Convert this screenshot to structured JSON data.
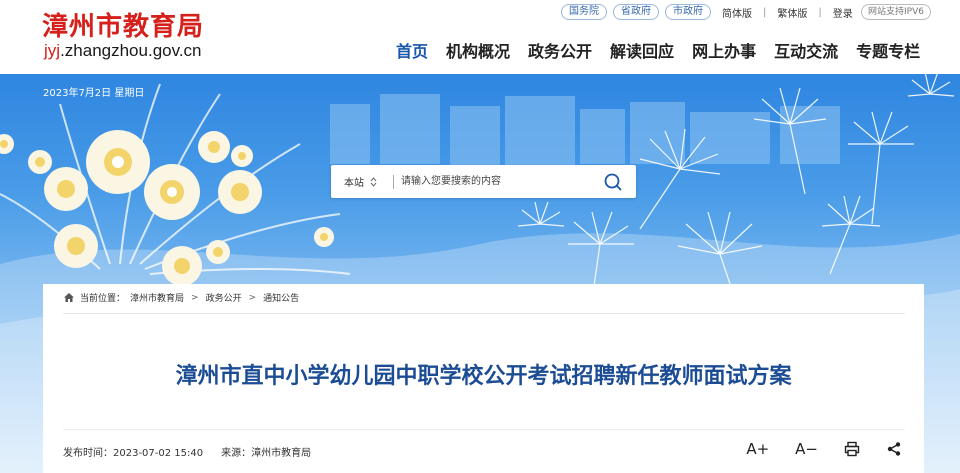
{
  "site": {
    "title": "漳州市教育局",
    "domain_prefix": "jyj",
    "domain_rest": ".zhangzhou.gov.cn"
  },
  "top_links": [
    "国务院",
    "省政府",
    "市政府"
  ],
  "utility": {
    "simplified": "简体版",
    "traditional": "繁体版",
    "login": "登录",
    "ipv6": "网站支持IPV6"
  },
  "nav": [
    {
      "label": "首页",
      "active": true
    },
    {
      "label": "机构概况",
      "active": false
    },
    {
      "label": "政务公开",
      "active": false
    },
    {
      "label": "解读回应",
      "active": false
    },
    {
      "label": "网上办事",
      "active": false
    },
    {
      "label": "互动交流",
      "active": false
    },
    {
      "label": "专题专栏",
      "active": false
    }
  ],
  "banner": {
    "date": "2023年7月2日 星期日"
  },
  "search": {
    "scope": "本站",
    "placeholder": "请输入您要搜索的内容",
    "icon": "search-icon"
  },
  "breadcrumb": {
    "prefix": "当前位置：",
    "items": [
      "漳州市教育局",
      "政务公开",
      "通知公告"
    ],
    "separator": ">"
  },
  "article": {
    "title": "漳州市直中小学幼儿园中职学校公开考试招聘新任教师面试方案",
    "publish_label": "发布时间：",
    "publish_time": "2023-07-02 15:40",
    "source_label": "来源：",
    "source": "漳州市教育局"
  },
  "tools": {
    "font_up": "A+",
    "font_down": "A−"
  },
  "colors": {
    "brand_red": "#d6201b",
    "nav_active": "#1756a8",
    "title_blue": "#1c4d94",
    "sky": "#3a8fe4"
  }
}
